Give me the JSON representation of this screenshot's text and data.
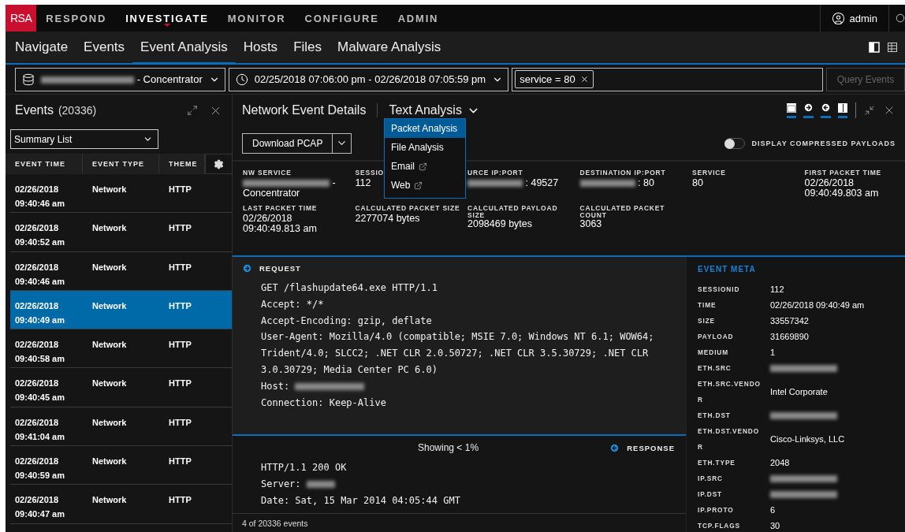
{
  "brand": {
    "logo": "RSA"
  },
  "top_nav": [
    {
      "label": "RESPOND",
      "selected": false
    },
    {
      "label": "INVESTIGATE",
      "selected": true
    },
    {
      "label": "MONITOR",
      "selected": false
    },
    {
      "label": "CONFIGURE",
      "selected": false
    },
    {
      "label": "ADMIN",
      "selected": false
    }
  ],
  "user": {
    "name": "admin"
  },
  "sub_nav": [
    {
      "label": "Navigate",
      "selected": false
    },
    {
      "label": "Events",
      "selected": false
    },
    {
      "label": "Event Analysis",
      "selected": true
    },
    {
      "label": "Hosts",
      "selected": false
    },
    {
      "label": "Files",
      "selected": false
    },
    {
      "label": "Malware Analysis",
      "selected": false
    }
  ],
  "query_bar": {
    "service": {
      "value": "- Concentrator",
      "masked": true
    },
    "time_range": "02/25/2018 07:06:00 pm - 02/26/2018 07:05:59 pm",
    "filters": [
      {
        "label": "service = 80"
      }
    ],
    "query_button": {
      "label": "Query Events",
      "disabled": true
    }
  },
  "events_panel": {
    "title": "Events",
    "count": "(20336)",
    "view_select": "Summary List",
    "columns": [
      "EVENT TIME",
      "EVENT TYPE",
      "THEME"
    ],
    "rows": [
      {
        "date": "02/26/2018",
        "time": "09:40:46 am",
        "type": "Network",
        "theme": "HTTP",
        "selected": false
      },
      {
        "date": "02/26/2018",
        "time": "09:40:52 am",
        "type": "Network",
        "theme": "HTTP",
        "selected": false
      },
      {
        "date": "02/26/2018",
        "time": "09:40:46 am",
        "type": "Network",
        "theme": "HTTP",
        "selected": false
      },
      {
        "date": "02/26/2018",
        "time": "09:40:49 am",
        "type": "Network",
        "theme": "HTTP",
        "selected": true
      },
      {
        "date": "02/26/2018",
        "time": "09:40:58 am",
        "type": "Network",
        "theme": "HTTP",
        "selected": false
      },
      {
        "date": "02/26/2018",
        "time": "09:40:45 am",
        "type": "Network",
        "theme": "HTTP",
        "selected": false
      },
      {
        "date": "02/26/2018",
        "time": "09:41:04 am",
        "type": "Network",
        "theme": "HTTP",
        "selected": false
      },
      {
        "date": "02/26/2018",
        "time": "09:40:59 am",
        "type": "Network",
        "theme": "HTTP",
        "selected": false
      },
      {
        "date": "02/26/2018",
        "time": "09:40:47 am",
        "type": "Network",
        "theme": "HTTP",
        "selected": false
      }
    ]
  },
  "details": {
    "title": "Network Event Details",
    "view_menu": {
      "label": "Text Analysis",
      "expanded": true,
      "items": [
        {
          "label": "Packet Analysis",
          "selected": true,
          "external": false
        },
        {
          "label": "File Analysis",
          "selected": false,
          "external": false
        },
        {
          "label": "Email",
          "selected": false,
          "external": true
        },
        {
          "label": "Web",
          "selected": false,
          "external": true
        }
      ]
    },
    "download_button": "Download PCAP",
    "compressed_toggle": {
      "label": "DISPLAY COMPRESSED PAYLOADS",
      "on": false
    },
    "summary": [
      [
        {
          "label": "NW SERVICE",
          "value": "- Concentrator",
          "masked": true
        },
        {
          "label": "SESSIO",
          "value": "112",
          "masked": false
        },
        {
          "label": "URCE IP:PORT",
          "value": ": 49527",
          "masked": true
        },
        {
          "label": "DESTINATION IP:PORT",
          "value": ": 80",
          "masked": true
        },
        {
          "label": "SERVICE",
          "value": "80",
          "masked": false
        },
        {
          "label": "FIRST PACKET TIME",
          "value": "02/26/2018 09:40:49.803 am",
          "masked": false
        }
      ],
      [
        {
          "label": "LAST PACKET TIME",
          "value": "02/26/2018 09:40:49.813 am",
          "masked": false
        },
        {
          "label": "CALCULATED PACKET SIZE",
          "value": "2277074 bytes",
          "masked": false
        },
        {
          "label": "CALCULATED PAYLOAD SIZE",
          "value": "2098469 bytes",
          "masked": false
        },
        {
          "label": "CALCULATED PACKET COUNT",
          "value": "3063",
          "masked": false
        }
      ]
    ],
    "request": {
      "label": "REQUEST",
      "lines": [
        {
          "text": "GET /flashupdate64.exe HTTP/1.1",
          "masked": false
        },
        {
          "text": "Accept: */*",
          "masked": false
        },
        {
          "text": "Accept-Encoding: gzip, deflate",
          "masked": false
        },
        {
          "text": "User-Agent: Mozilla/4.0 (compatible; MSIE 7.0; Windows NT 6.1; WOW64; Trident/4.0; SLCC2; .NET CLR 2.0.50727; .NET CLR 3.5.30729; .NET CLR 3.0.30729; Media Center PC 6.0)",
          "masked": false
        },
        {
          "text": "Host:",
          "masked": true
        },
        {
          "text": "Connection: Keep-Alive",
          "masked": false
        }
      ]
    },
    "response": {
      "label": "RESPONSE",
      "showing": "Showing < 1%",
      "lines": [
        {
          "text": "HTTP/1.1 200 OK",
          "masked": false
        },
        {
          "text": "Server:",
          "masked": true
        },
        {
          "text": "Date: Sat, 15 Mar 2014 04:05:44 GMT",
          "masked": false
        }
      ]
    },
    "footer": "4 of 20336 events",
    "event_meta": {
      "title": "EVENT META",
      "rows": [
        {
          "label": "SESSIONID",
          "value": "112",
          "masked": false
        },
        {
          "label": "TIME",
          "value": "02/26/2018 09:40:49 am",
          "masked": false
        },
        {
          "label": "SIZE",
          "value": "33557342",
          "masked": false
        },
        {
          "label": "PAYLOAD",
          "value": "31669890",
          "masked": false
        },
        {
          "label": "MEDIUM",
          "value": "1",
          "masked": false
        },
        {
          "label": "ETH.SRC",
          "masked": true
        },
        {
          "label": "ETH.SRC.VENDOR",
          "value": "Intel Corporate",
          "masked": false
        },
        {
          "label": "ETH.DST",
          "masked": true
        },
        {
          "label": "ETH.DST.VENDOR",
          "value": "Cisco-Linksys, LLC",
          "masked": false
        },
        {
          "label": "ETH.TYPE",
          "value": "2048",
          "masked": false
        },
        {
          "label": "IP.SRC",
          "masked": true
        },
        {
          "label": "IP.DST",
          "masked": true
        },
        {
          "label": "IP.PROTO",
          "value": "6",
          "masked": false
        },
        {
          "label": "TCP.FLAGS",
          "value": "30",
          "masked": false
        }
      ]
    }
  }
}
